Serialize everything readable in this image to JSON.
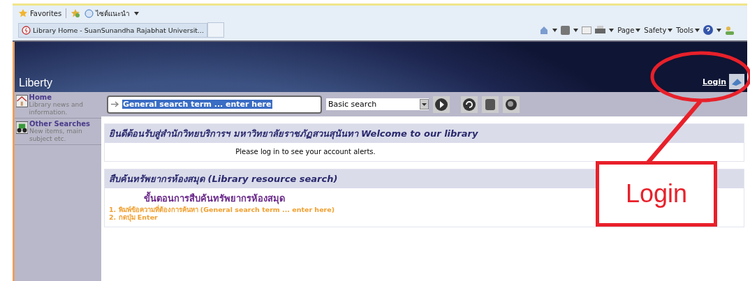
{
  "browser": {
    "favorites": "Favorites",
    "suggested_sites": "ไซต์แนะนำ",
    "tab_title": "Library Home - SuanSunandha Rajabhat Universit...",
    "commands": [
      "Page",
      "Safety",
      "Tools"
    ]
  },
  "site": {
    "logo": "Liberty",
    "login": "Login",
    "sidebar": {
      "items": [
        {
          "title": "Home",
          "description": "Library news and information."
        },
        {
          "title": "Other Searches",
          "description": "New items, main subject etc."
        }
      ]
    },
    "search": {
      "value": "General search term ... enter here",
      "search_type": "Basic search"
    },
    "welcome": {
      "heading": "ยินดีต้อนรับสู่สำนักวิทยบริการฯ มหาวิทยาลัยราชภัฏสวนสุนันทา Welcome to our library",
      "alert": "Please log in to see your account alerts."
    },
    "resource_search": {
      "heading": "สืบค้นทรัพยากรห้องสมุด (Library resource search)",
      "steps_title": "ขั้นตอนการสืบค้นทรัพยากรห้องสมุด",
      "steps": [
        "1. พิมพ์ข้อความที่ต้องการค้นหา (General search term ... enter here)",
        "2. กดปุ่ม Enter"
      ]
    }
  },
  "annotation": {
    "label": "Login"
  }
}
